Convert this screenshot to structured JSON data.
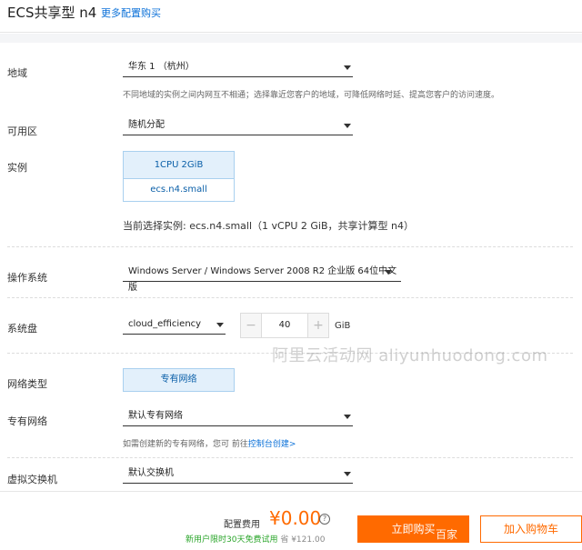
{
  "header": {
    "title": "ECS共享型 n4",
    "more_link": "更多配置购买"
  },
  "region": {
    "label": "地域",
    "value": "华东 1 （杭州）",
    "hint": "不同地域的实例之间内网互不相通；选择靠近您客户的地域，可降低网络时延、提高您客户的访问速度。"
  },
  "zone": {
    "label": "可用区",
    "value": "随机分配"
  },
  "instance": {
    "label": "实例",
    "spec": "1CPU 2GiB",
    "type": "ecs.n4.small",
    "current": "当前选择实例: ecs.n4.small（1 vCPU 2 GiB，共享计算型 n4）"
  },
  "os": {
    "label": "操作系统",
    "value": "Windows Server / Windows Server 2008 R2 企业版 64位中文版"
  },
  "disk": {
    "label": "系统盘",
    "type": "cloud_efficiency",
    "minus": "−",
    "size": "40",
    "plus": "+",
    "unit": "GiB"
  },
  "network_type": {
    "label": "网络类型",
    "value": "专有网络"
  },
  "vpc": {
    "label": "专有网络",
    "value": "默认专有网络",
    "hint_prefix": "如需创建新的专有网络，您可 前往",
    "hint_link": "控制台创建>"
  },
  "vswitch": {
    "label": "虚拟交换机",
    "value": "默认交换机"
  },
  "watermark": "阿里云活动网  aliyunhuodong.com",
  "footer": {
    "fee_label": "配置费用",
    "price": "¥0.00",
    "help": "?",
    "promo": "新用户限时30天免费试用",
    "orig_prefix": "省 ",
    "orig_price": "¥121.00",
    "buy_label": "立即购买",
    "buy_overlay": "百家",
    "cart_label": "加入购物车"
  },
  "colors": {
    "accent": "#ff6a00",
    "link": "#0a70d8",
    "selected_bg": "#e3f0fb"
  }
}
